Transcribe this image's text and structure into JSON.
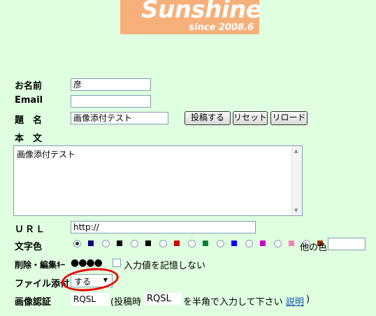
{
  "logo": {
    "title": "Sunshine",
    "since": "since 2008.6"
  },
  "form": {
    "name_label": "お名前",
    "name_value": "彦",
    "email_label": "Email",
    "email_value": "",
    "subject_label": "題　名",
    "subject_value": "画像添付テスト",
    "submit_label": "投稿する",
    "reset_label": "リセット",
    "reload_label": "リロード",
    "body_label": "本　文",
    "body_value": "画像添付テスト",
    "url_label": "ＵＲＬ",
    "url_value": "http://",
    "color_label": "文字色",
    "colors": [
      "#000080",
      "#000000",
      "#000000",
      "#cc0000",
      "#008040",
      "#0000ff",
      "#cc00cc",
      "#ff80c0",
      "#993300"
    ],
    "color_selected_index": 0,
    "other_color_label": "他の色",
    "other_color_value": "",
    "delkey_label": "削除・編集ｷｰ",
    "delkey_value": "●●●●",
    "remember_label": "入力値を記憶しない",
    "file_label": "ファイル添付",
    "file_value": "する",
    "auth_label": "画像認証",
    "auth_value": "RQSL",
    "auth_prefix": "(投稿時",
    "auth_code": "RQSL",
    "auth_suffix": "を半角で入力して下さい",
    "auth_help": "説明",
    "auth_close": ")"
  }
}
